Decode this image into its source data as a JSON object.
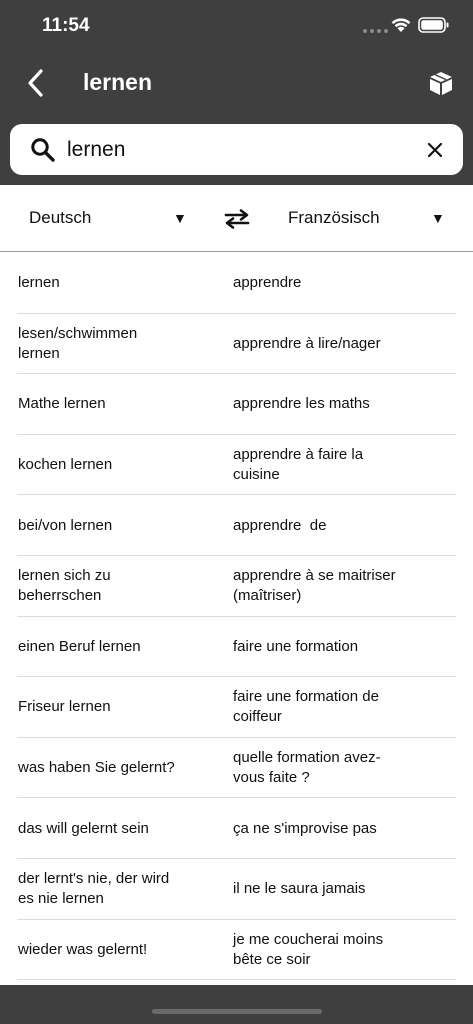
{
  "status": {
    "time": "11:54"
  },
  "nav": {
    "title": "lernen",
    "back_icon": "chevron-left-icon",
    "box_icon": "box-icon"
  },
  "search": {
    "value": "lernen",
    "placeholder": "",
    "icon": "search-icon",
    "clear_icon": "close-icon"
  },
  "languages": {
    "source": "Deutsch",
    "target": "Französisch",
    "dropdown_glyph": "▼",
    "swap_icon": "swap-arrows-icon"
  },
  "results": [
    {
      "de": "lernen",
      "fr": "apprendre"
    },
    {
      "de": "lesen/schwimmen\nlernen",
      "fr": "apprendre à lire/nager"
    },
    {
      "de": "Mathe lernen",
      "fr": "apprendre les maths"
    },
    {
      "de": "kochen lernen",
      "fr": "apprendre à faire la\ncuisine"
    },
    {
      "de": "bei/von lernen",
      "fr": "apprendre  de"
    },
    {
      "de": "lernen sich zu\nbeherrschen",
      "fr": "apprendre à se maitriser\n(maîtriser)"
    },
    {
      "de": "einen Beruf lernen",
      "fr": "faire une formation"
    },
    {
      "de": "Friseur lernen",
      "fr": "faire une formation de\ncoiffeur"
    },
    {
      "de": "was haben Sie gelernt?",
      "fr": "quelle formation avez-\nvous faite ?"
    },
    {
      "de": "das will gelernt sein",
      "fr": "ça ne s'improvise pas"
    },
    {
      "de": "der lernt's nie, der wird\nes nie lernen",
      "fr": "il ne le saura jamais"
    },
    {
      "de": "wieder was gelernt!",
      "fr": "je me coucherai moins\nbête ce soir"
    }
  ],
  "colors": {
    "header": "#3f3f3f",
    "background": "#ffffff",
    "text": "#111111",
    "divider": "#dcdcdc"
  }
}
